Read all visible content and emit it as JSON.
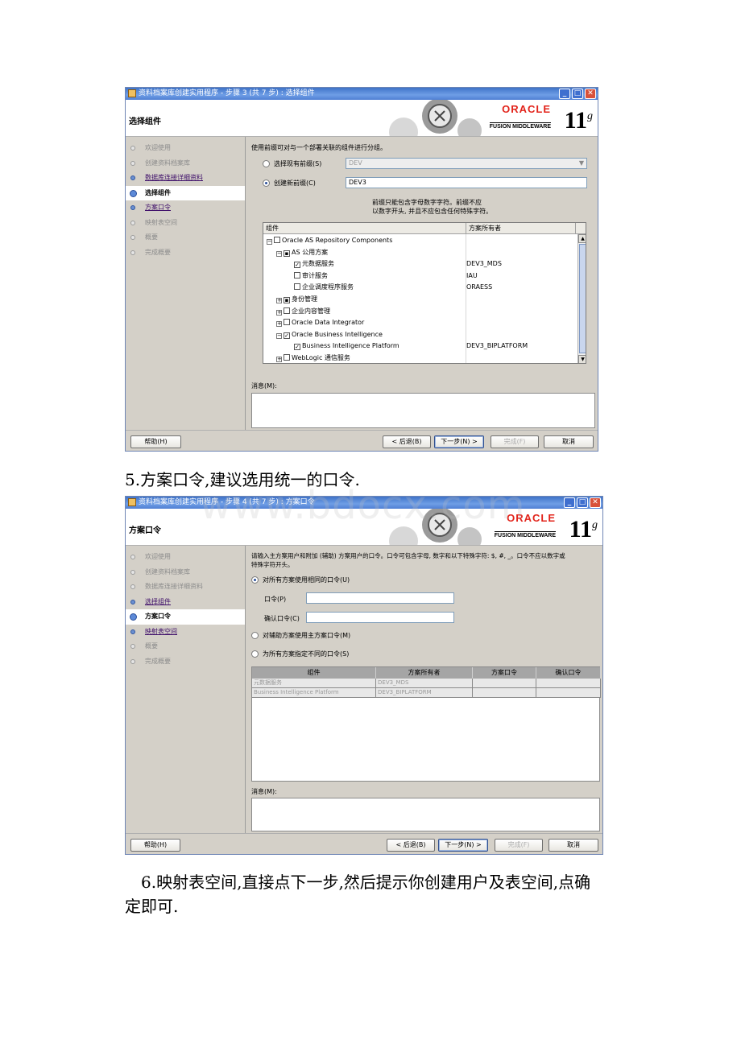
{
  "window1": {
    "title": "资料档案库创建实用程序 - 步骤 3 (共 7 步) : 选择组件",
    "header_title": "选择组件",
    "oracle_logo": "ORACLE",
    "fusion_middleware": "FUSION MIDDLEWARE",
    "version": "11",
    "version_suffix": "g",
    "steps": [
      "欢迎使用",
      "创建资料档案库",
      "数据库连接详细资料",
      "选择组件",
      "方案口令",
      "映射表空间",
      "概要",
      "完成概要"
    ],
    "instruction": "使用前缀可对与一个部署关联的组件进行分组。",
    "radio_existing": "选择现有前缀(S)",
    "existing_value": "DEV",
    "radio_new": "创建新前缀(C)",
    "new_value": "DEV3",
    "note_line1": "前缀只能包含字母数字字符。前缀不应",
    "note_line2": "以数字开头, 并且不应包含任何特殊字符。",
    "col_component": "组件",
    "col_owner": "方案所有者",
    "rows": [
      {
        "name": "Oracle AS Repository Components",
        "owner": ""
      },
      {
        "name": "AS 公用方案",
        "owner": ""
      },
      {
        "name": "元数据服务",
        "owner": "DEV3_MDS"
      },
      {
        "name": "审计服务",
        "owner": "IAU"
      },
      {
        "name": "企业调度程序服务",
        "owner": "ORAESS"
      },
      {
        "name": "身份管理",
        "owner": ""
      },
      {
        "name": "企业内容管理",
        "owner": ""
      },
      {
        "name": "Oracle Data Integrator",
        "owner": ""
      },
      {
        "name": "Oracle Business Intelligence",
        "owner": ""
      },
      {
        "name": "Business Intelligence Platform",
        "owner": "DEV3_BIPLATFORM"
      },
      {
        "name": "WebLogic 通信服务",
        "owner": ""
      }
    ],
    "message_label": "消息(M):",
    "btn_help": "帮助(H)",
    "btn_back": "< 后退(B)",
    "btn_next": "下一步(N) >",
    "btn_finish": "完成(F)",
    "btn_cancel": "取消"
  },
  "para5": "5.方案口令,建议选用统一的口令.",
  "window2": {
    "title": "资料档案库创建实用程序 - 步骤 4 (共 7 步) : 方案口令",
    "header_title": "方案口令",
    "instruction_line1": "请输入主方案用户和附加 (辅助) 方案用户的口令。口令可包含字母, 数字和以下特殊字符: $, #, _。口令不应以数字或",
    "instruction_line2": "特殊字符开头。",
    "radio_same": "对所有方案使用相同的口令(U)",
    "label_password": "口令(P)",
    "label_confirm": "确认口令(C)",
    "radio_aux": "对辅助方案使用主方案口令(M)",
    "radio_diff": "为所有方案指定不同的口令(S)",
    "grid_headers": [
      "组件",
      "方案所有者",
      "方案口令",
      "确认口令"
    ],
    "grid_rows": [
      {
        "component": "元数据服务",
        "owner": "DEV3_MDS"
      },
      {
        "component": "Business Intelligence Platform",
        "owner": "DEV3_BIPLATFORM"
      }
    ],
    "message_label": "消息(M):",
    "btn_help": "帮助(H)",
    "btn_back": "< 后退(B)",
    "btn_next": "下一步(N) >",
    "btn_finish": "完成(F)",
    "btn_cancel": "取消"
  },
  "para6_line1": "6.映射表空间,直接点下一步,然后提示你创建用户及表空间,点确",
  "para6_line2": "定即可.",
  "watermark": "www.bdocx.com"
}
